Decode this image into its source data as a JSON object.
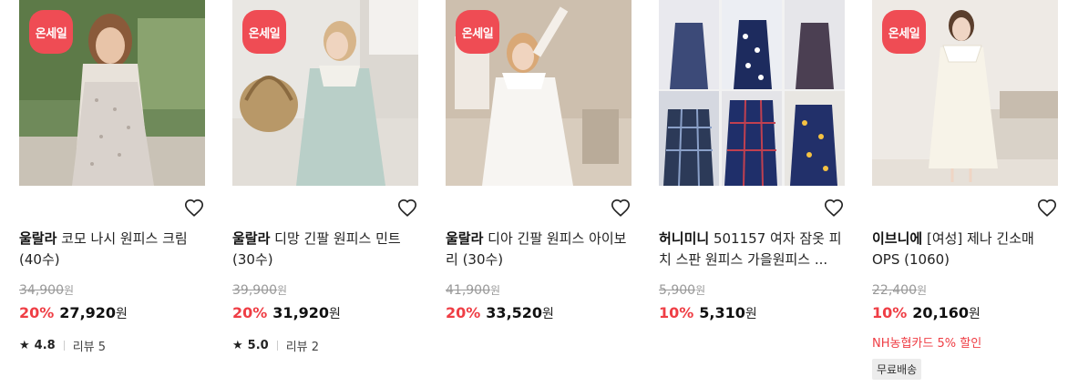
{
  "badge_text": "온세일",
  "heart_icon": "heart-outline-icon",
  "star_icon": "star-filled-icon",
  "currency": "원",
  "products": [
    {
      "brand": "울랄라",
      "name": " 코모 나시 원피스 크림 (40수)",
      "original_price": "34,900",
      "discount": "20%",
      "price": "27,920",
      "rating": "4.8",
      "review": "리뷰 5"
    },
    {
      "brand": "울랄라",
      "name": " 디망 긴팔 원피스 민트 (30수)",
      "original_price": "39,900",
      "discount": "20%",
      "price": "31,920",
      "rating": "5.0",
      "review": "리뷰 2"
    },
    {
      "brand": "울랄라",
      "name": " 디아 긴팔 원피스 아이보리 (30수)",
      "original_price": "41,900",
      "discount": "20%",
      "price": "33,520"
    },
    {
      "brand": "허니미니",
      "name": " 501157 여자 잠옷 피치 스판 원피스 가을원피스 ...",
      "original_price": "5,900",
      "discount": "10%",
      "price": "5,310"
    },
    {
      "brand": "이브니에",
      "name": " [여성] 제나 긴소매 OPS (1060)",
      "original_price": "22,400",
      "discount": "10%",
      "price": "20,160",
      "promo": "NH농협카드 5% 할인",
      "tag": "무료배송"
    }
  ]
}
